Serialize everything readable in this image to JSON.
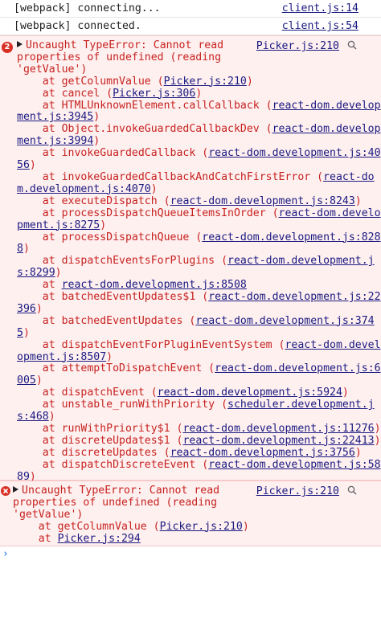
{
  "logs": [
    {
      "message": "[webpack] connecting...",
      "source": "client.js:14"
    },
    {
      "message": "[webpack] connected.",
      "source": "client.js:54"
    }
  ],
  "error1": {
    "count": "2",
    "source": "Picker.js:210",
    "lines": [
      [
        {
          "t": "Uncaught TypeError: Cannot read"
        }
      ],
      [
        {
          "t": "properties of undefined (reading"
        }
      ],
      [
        {
          "t": "'getValue')"
        }
      ],
      [
        {
          "t": "    at getColumnValue ("
        },
        {
          "t": "Picker.js:210",
          "l": 1
        },
        {
          "t": ")"
        }
      ],
      [
        {
          "t": "    at cancel ("
        },
        {
          "t": "Picker.js:306",
          "l": 1
        },
        {
          "t": ")"
        }
      ],
      [
        {
          "t": "    at HTMLUnknownElement.callCallback ("
        },
        {
          "t": "react-dom.develop",
          "l": 1
        }
      ],
      [
        {
          "t": "ment.js:3945",
          "l": 1
        },
        {
          "t": ")"
        }
      ],
      [
        {
          "t": "    at Object.invokeGuardedCallbackDev ("
        },
        {
          "t": "react-dom.develop",
          "l": 1
        }
      ],
      [
        {
          "t": "ment.js:3994",
          "l": 1
        },
        {
          "t": ")"
        }
      ],
      [
        {
          "t": "    at invokeGuardedCallback ("
        },
        {
          "t": "react-dom.development.js:40",
          "l": 1
        }
      ],
      [
        {
          "t": "56",
          "l": 1
        },
        {
          "t": ")"
        }
      ],
      [
        {
          "t": "    at invokeGuardedCallbackAndCatchFirstError ("
        },
        {
          "t": "react-do",
          "l": 1
        }
      ],
      [
        {
          "t": "m.development.js:4070",
          "l": 1
        },
        {
          "t": ")"
        }
      ],
      [
        {
          "t": "    at executeDispatch ("
        },
        {
          "t": "react-dom.development.js:8243",
          "l": 1
        },
        {
          "t": ")"
        }
      ],
      [
        {
          "t": "    at processDispatchQueueItemsInOrder ("
        },
        {
          "t": "react-dom.develo",
          "l": 1
        }
      ],
      [
        {
          "t": "pment.js:8275",
          "l": 1
        },
        {
          "t": ")"
        }
      ],
      [
        {
          "t": "    at processDispatchQueue ("
        },
        {
          "t": "react-dom.development.js:828",
          "l": 1
        }
      ],
      [
        {
          "t": "8",
          "l": 1
        },
        {
          "t": ")"
        }
      ],
      [
        {
          "t": "    at dispatchEventsForPlugins ("
        },
        {
          "t": "react-dom.development.j",
          "l": 1
        }
      ],
      [
        {
          "t": "s:8299",
          "l": 1
        },
        {
          "t": ")"
        }
      ],
      [
        {
          "t": "    at "
        },
        {
          "t": "react-dom.development.js:8508",
          "l": 1
        }
      ],
      [
        {
          "t": "    at batchedEventUpdates$1 ("
        },
        {
          "t": "react-dom.development.js:22",
          "l": 1
        }
      ],
      [
        {
          "t": "396",
          "l": 1
        },
        {
          "t": ")"
        }
      ],
      [
        {
          "t": "    at batchedEventUpdates ("
        },
        {
          "t": "react-dom.development.js:374",
          "l": 1
        }
      ],
      [
        {
          "t": "5",
          "l": 1
        },
        {
          "t": ")"
        }
      ],
      [
        {
          "t": "    at dispatchEventForPluginEventSystem ("
        },
        {
          "t": "react-dom.devel",
          "l": 1
        }
      ],
      [
        {
          "t": "opment.js:8507",
          "l": 1
        },
        {
          "t": ")"
        }
      ],
      [
        {
          "t": "    at attemptToDispatchEvent ("
        },
        {
          "t": "react-dom.development.js:6",
          "l": 1
        }
      ],
      [
        {
          "t": "005",
          "l": 1
        },
        {
          "t": ")"
        }
      ],
      [
        {
          "t": "    at dispatchEvent ("
        },
        {
          "t": "react-dom.development.js:5924",
          "l": 1
        },
        {
          "t": ")"
        }
      ],
      [
        {
          "t": "    at unstable_runWithPriority ("
        },
        {
          "t": "scheduler.development.j",
          "l": 1
        }
      ],
      [
        {
          "t": "s:468",
          "l": 1
        },
        {
          "t": ")"
        }
      ],
      [
        {
          "t": "    at runWithPriority$1 ("
        },
        {
          "t": "react-dom.development.js:11276",
          "l": 1
        },
        {
          "t": ")"
        }
      ],
      [
        {
          "t": "    at discreteUpdates$1 ("
        },
        {
          "t": "react-dom.development.js:22413",
          "l": 1
        },
        {
          "t": ")"
        }
      ],
      [
        {
          "t": "    at discreteUpdates ("
        },
        {
          "t": "react-dom.development.js:3756",
          "l": 1
        },
        {
          "t": ")"
        }
      ],
      [
        {
          "t": "    at dispatchDiscreteEvent ("
        },
        {
          "t": "react-dom.development.js:58",
          "l": 1
        }
      ],
      [
        {
          "t": "89",
          "l": 1
        },
        {
          "t": ")"
        }
      ]
    ]
  },
  "error2": {
    "source": "Picker.js:210",
    "lines": [
      [
        {
          "t": "Uncaught TypeError: Cannot read"
        }
      ],
      [
        {
          "t": "properties of undefined (reading"
        }
      ],
      [
        {
          "t": "'getValue')"
        }
      ],
      [
        {
          "t": "    at getColumnValue ("
        },
        {
          "t": "Picker.js:210",
          "l": 1
        },
        {
          "t": ")"
        }
      ],
      [
        {
          "t": "    at "
        },
        {
          "t": "Picker.js:294",
          "l": 1
        }
      ]
    ]
  },
  "prompt": {
    "caret": "›"
  },
  "colors": {
    "error_text": "#c5221f",
    "error_bg": "#fff0f0",
    "link": "#1a1a80",
    "badge": "#d93025"
  }
}
